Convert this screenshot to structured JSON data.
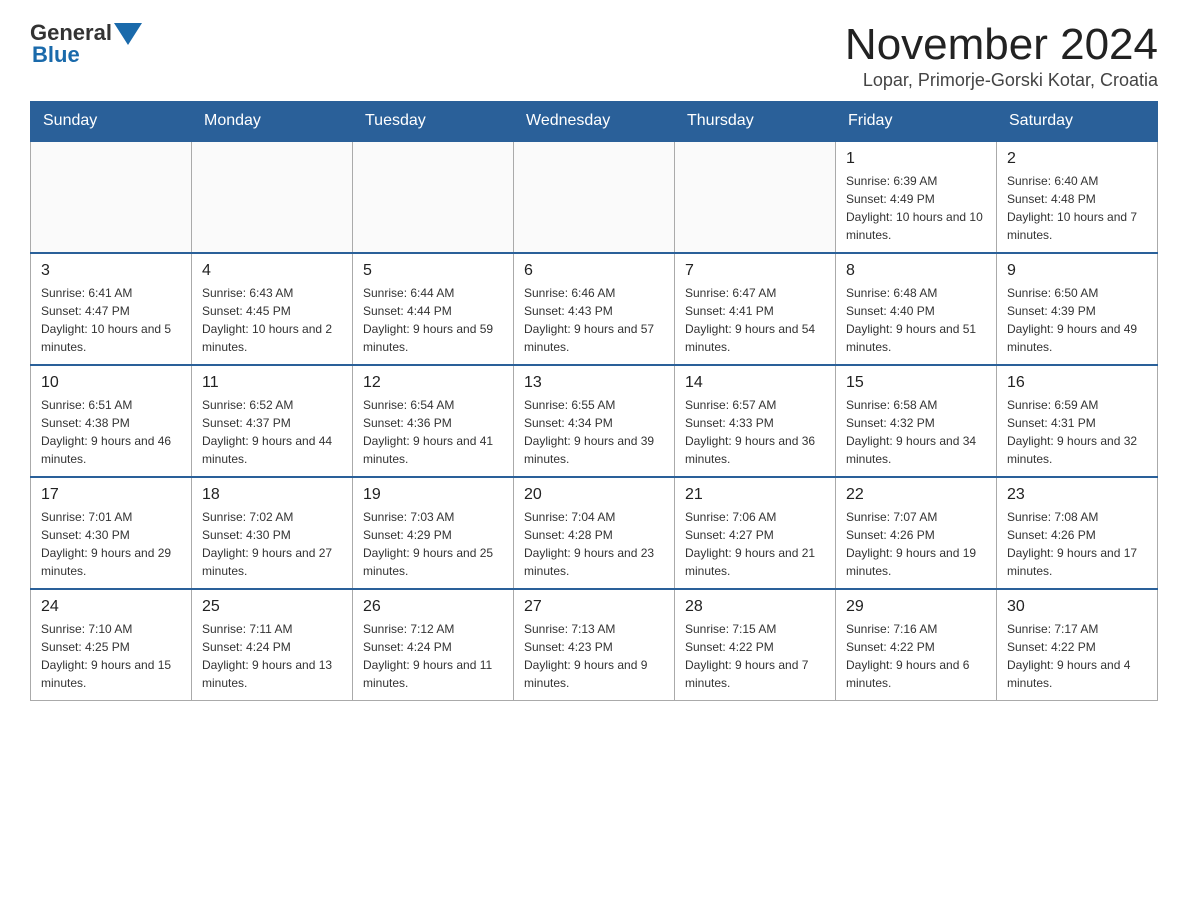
{
  "logo": {
    "text_general": "General",
    "text_blue": "Blue"
  },
  "title": "November 2024",
  "subtitle": "Lopar, Primorje-Gorski Kotar, Croatia",
  "days_of_week": [
    "Sunday",
    "Monday",
    "Tuesday",
    "Wednesday",
    "Thursday",
    "Friday",
    "Saturday"
  ],
  "weeks": [
    [
      {
        "day": "",
        "info": ""
      },
      {
        "day": "",
        "info": ""
      },
      {
        "day": "",
        "info": ""
      },
      {
        "day": "",
        "info": ""
      },
      {
        "day": "",
        "info": ""
      },
      {
        "day": "1",
        "info": "Sunrise: 6:39 AM\nSunset: 4:49 PM\nDaylight: 10 hours and 10 minutes."
      },
      {
        "day": "2",
        "info": "Sunrise: 6:40 AM\nSunset: 4:48 PM\nDaylight: 10 hours and 7 minutes."
      }
    ],
    [
      {
        "day": "3",
        "info": "Sunrise: 6:41 AM\nSunset: 4:47 PM\nDaylight: 10 hours and 5 minutes."
      },
      {
        "day": "4",
        "info": "Sunrise: 6:43 AM\nSunset: 4:45 PM\nDaylight: 10 hours and 2 minutes."
      },
      {
        "day": "5",
        "info": "Sunrise: 6:44 AM\nSunset: 4:44 PM\nDaylight: 9 hours and 59 minutes."
      },
      {
        "day": "6",
        "info": "Sunrise: 6:46 AM\nSunset: 4:43 PM\nDaylight: 9 hours and 57 minutes."
      },
      {
        "day": "7",
        "info": "Sunrise: 6:47 AM\nSunset: 4:41 PM\nDaylight: 9 hours and 54 minutes."
      },
      {
        "day": "8",
        "info": "Sunrise: 6:48 AM\nSunset: 4:40 PM\nDaylight: 9 hours and 51 minutes."
      },
      {
        "day": "9",
        "info": "Sunrise: 6:50 AM\nSunset: 4:39 PM\nDaylight: 9 hours and 49 minutes."
      }
    ],
    [
      {
        "day": "10",
        "info": "Sunrise: 6:51 AM\nSunset: 4:38 PM\nDaylight: 9 hours and 46 minutes."
      },
      {
        "day": "11",
        "info": "Sunrise: 6:52 AM\nSunset: 4:37 PM\nDaylight: 9 hours and 44 minutes."
      },
      {
        "day": "12",
        "info": "Sunrise: 6:54 AM\nSunset: 4:36 PM\nDaylight: 9 hours and 41 minutes."
      },
      {
        "day": "13",
        "info": "Sunrise: 6:55 AM\nSunset: 4:34 PM\nDaylight: 9 hours and 39 minutes."
      },
      {
        "day": "14",
        "info": "Sunrise: 6:57 AM\nSunset: 4:33 PM\nDaylight: 9 hours and 36 minutes."
      },
      {
        "day": "15",
        "info": "Sunrise: 6:58 AM\nSunset: 4:32 PM\nDaylight: 9 hours and 34 minutes."
      },
      {
        "day": "16",
        "info": "Sunrise: 6:59 AM\nSunset: 4:31 PM\nDaylight: 9 hours and 32 minutes."
      }
    ],
    [
      {
        "day": "17",
        "info": "Sunrise: 7:01 AM\nSunset: 4:30 PM\nDaylight: 9 hours and 29 minutes."
      },
      {
        "day": "18",
        "info": "Sunrise: 7:02 AM\nSunset: 4:30 PM\nDaylight: 9 hours and 27 minutes."
      },
      {
        "day": "19",
        "info": "Sunrise: 7:03 AM\nSunset: 4:29 PM\nDaylight: 9 hours and 25 minutes."
      },
      {
        "day": "20",
        "info": "Sunrise: 7:04 AM\nSunset: 4:28 PM\nDaylight: 9 hours and 23 minutes."
      },
      {
        "day": "21",
        "info": "Sunrise: 7:06 AM\nSunset: 4:27 PM\nDaylight: 9 hours and 21 minutes."
      },
      {
        "day": "22",
        "info": "Sunrise: 7:07 AM\nSunset: 4:26 PM\nDaylight: 9 hours and 19 minutes."
      },
      {
        "day": "23",
        "info": "Sunrise: 7:08 AM\nSunset: 4:26 PM\nDaylight: 9 hours and 17 minutes."
      }
    ],
    [
      {
        "day": "24",
        "info": "Sunrise: 7:10 AM\nSunset: 4:25 PM\nDaylight: 9 hours and 15 minutes."
      },
      {
        "day": "25",
        "info": "Sunrise: 7:11 AM\nSunset: 4:24 PM\nDaylight: 9 hours and 13 minutes."
      },
      {
        "day": "26",
        "info": "Sunrise: 7:12 AM\nSunset: 4:24 PM\nDaylight: 9 hours and 11 minutes."
      },
      {
        "day": "27",
        "info": "Sunrise: 7:13 AM\nSunset: 4:23 PM\nDaylight: 9 hours and 9 minutes."
      },
      {
        "day": "28",
        "info": "Sunrise: 7:15 AM\nSunset: 4:22 PM\nDaylight: 9 hours and 7 minutes."
      },
      {
        "day": "29",
        "info": "Sunrise: 7:16 AM\nSunset: 4:22 PM\nDaylight: 9 hours and 6 minutes."
      },
      {
        "day": "30",
        "info": "Sunrise: 7:17 AM\nSunset: 4:22 PM\nDaylight: 9 hours and 4 minutes."
      }
    ]
  ]
}
